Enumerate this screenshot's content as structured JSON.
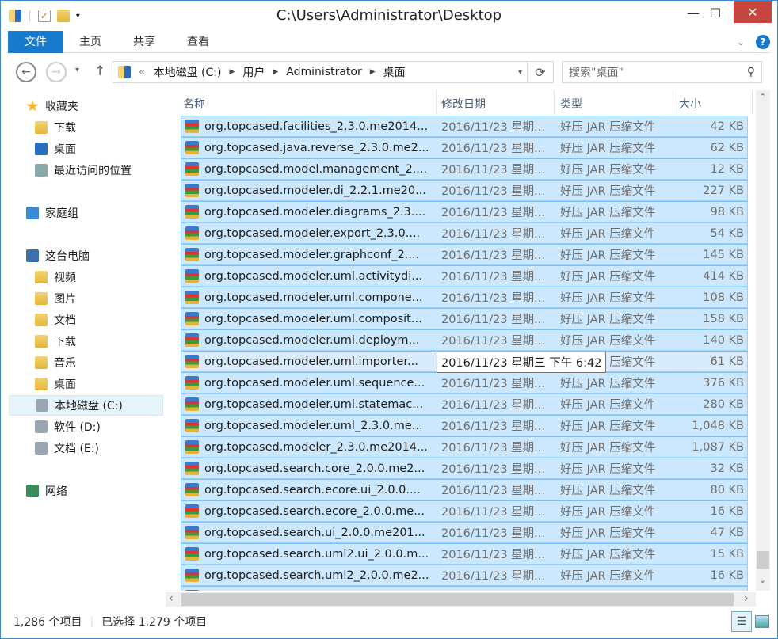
{
  "window": {
    "title": "C:\\Users\\Administrator\\Desktop",
    "minimize": "—",
    "maximize": "☐",
    "close": "✕"
  },
  "ribbon": {
    "tabs": [
      "文件",
      "主页",
      "共享",
      "查看"
    ]
  },
  "address": {
    "prefix": "«",
    "crumbs": [
      "本地磁盘 (C:)",
      "用户",
      "Administrator",
      "桌面"
    ],
    "search_placeholder": "搜索\"桌面\""
  },
  "nav": {
    "items": [
      {
        "label": "收藏夹",
        "icon": "star-icon"
      },
      {
        "label": "下载",
        "icon": "folder-icon"
      },
      {
        "label": "桌面",
        "icon": "desktop-icon"
      },
      {
        "label": "最近访问的位置",
        "icon": "recent-icon"
      },
      {
        "label": "家庭组",
        "icon": "homegroup-icon"
      },
      {
        "label": "这台电脑",
        "icon": "computer-icon"
      },
      {
        "label": "视频",
        "icon": "folder-icon"
      },
      {
        "label": "图片",
        "icon": "folder-icon"
      },
      {
        "label": "文档",
        "icon": "folder-icon"
      },
      {
        "label": "下载",
        "icon": "folder-icon"
      },
      {
        "label": "音乐",
        "icon": "folder-icon"
      },
      {
        "label": "桌面",
        "icon": "folder-icon"
      },
      {
        "label": "本地磁盘 (C:)",
        "icon": "drive-icon",
        "selected": true
      },
      {
        "label": "软件 (D:)",
        "icon": "drive-icon"
      },
      {
        "label": "文档 (E:)",
        "icon": "drive-icon"
      },
      {
        "label": "网络",
        "icon": "network-icon"
      }
    ]
  },
  "columns": {
    "name": "名称",
    "date": "修改日期",
    "type": "类型",
    "size": "大小"
  },
  "files": [
    {
      "name": "org.topcased.facilities_2.3.0.me2014...",
      "size": "42 KB"
    },
    {
      "name": "org.topcased.java.reverse_2.3.0.me2...",
      "size": "62 KB"
    },
    {
      "name": "org.topcased.model.management_2....",
      "size": "12 KB"
    },
    {
      "name": "org.topcased.modeler.di_2.2.1.me20...",
      "size": "227 KB"
    },
    {
      "name": "org.topcased.modeler.diagrams_2.3....",
      "size": "98 KB"
    },
    {
      "name": "org.topcased.modeler.export_2.3.0....",
      "size": "54 KB"
    },
    {
      "name": "org.topcased.modeler.graphconf_2....",
      "size": "145 KB"
    },
    {
      "name": "org.topcased.modeler.uml.activitydi...",
      "size": "414 KB"
    },
    {
      "name": "org.topcased.modeler.uml.compone...",
      "size": "108 KB"
    },
    {
      "name": "org.topcased.modeler.uml.composit...",
      "size": "158 KB"
    },
    {
      "name": "org.topcased.modeler.uml.deploym...",
      "size": "140 KB"
    },
    {
      "name": "org.topcased.modeler.uml.importer...",
      "size": "61 KB"
    },
    {
      "name": "org.topcased.modeler.uml.sequence...",
      "size": "376 KB"
    },
    {
      "name": "org.topcased.modeler.uml.statemac...",
      "size": "280 KB"
    },
    {
      "name": "org.topcased.modeler.uml_2.3.0.me...",
      "size": "1,048 KB"
    },
    {
      "name": "org.topcased.modeler_2.3.0.me2014...",
      "size": "1,087 KB"
    },
    {
      "name": "org.topcased.search.core_2.0.0.me2...",
      "size": "32 KB"
    },
    {
      "name": "org.topcased.search.ecore.ui_2.0.0....",
      "size": "80 KB"
    },
    {
      "name": "org.topcased.search.ecore_2.0.0.me...",
      "size": "16 KB"
    },
    {
      "name": "org.topcased.search.ui_2.0.0.me201...",
      "size": "47 KB"
    },
    {
      "name": "org.topcased.search.uml2.ui_2.0.0.m...",
      "size": "15 KB"
    },
    {
      "name": "org.topcased.search.uml2_2.0.0.me2...",
      "size": "16 KB"
    }
  ],
  "file_date": "2016/11/23 星期...",
  "file_type": "好压 JAR 压缩文件",
  "tooltip": "2016/11/23 星期三 下午 6:42",
  "status": {
    "count": "1,286 个项目",
    "selected": "已选择 1,279 个项目"
  },
  "colors": {
    "accent": "#1979ca",
    "selection": "#cce8ff",
    "selection_border": "#99d1ff"
  }
}
